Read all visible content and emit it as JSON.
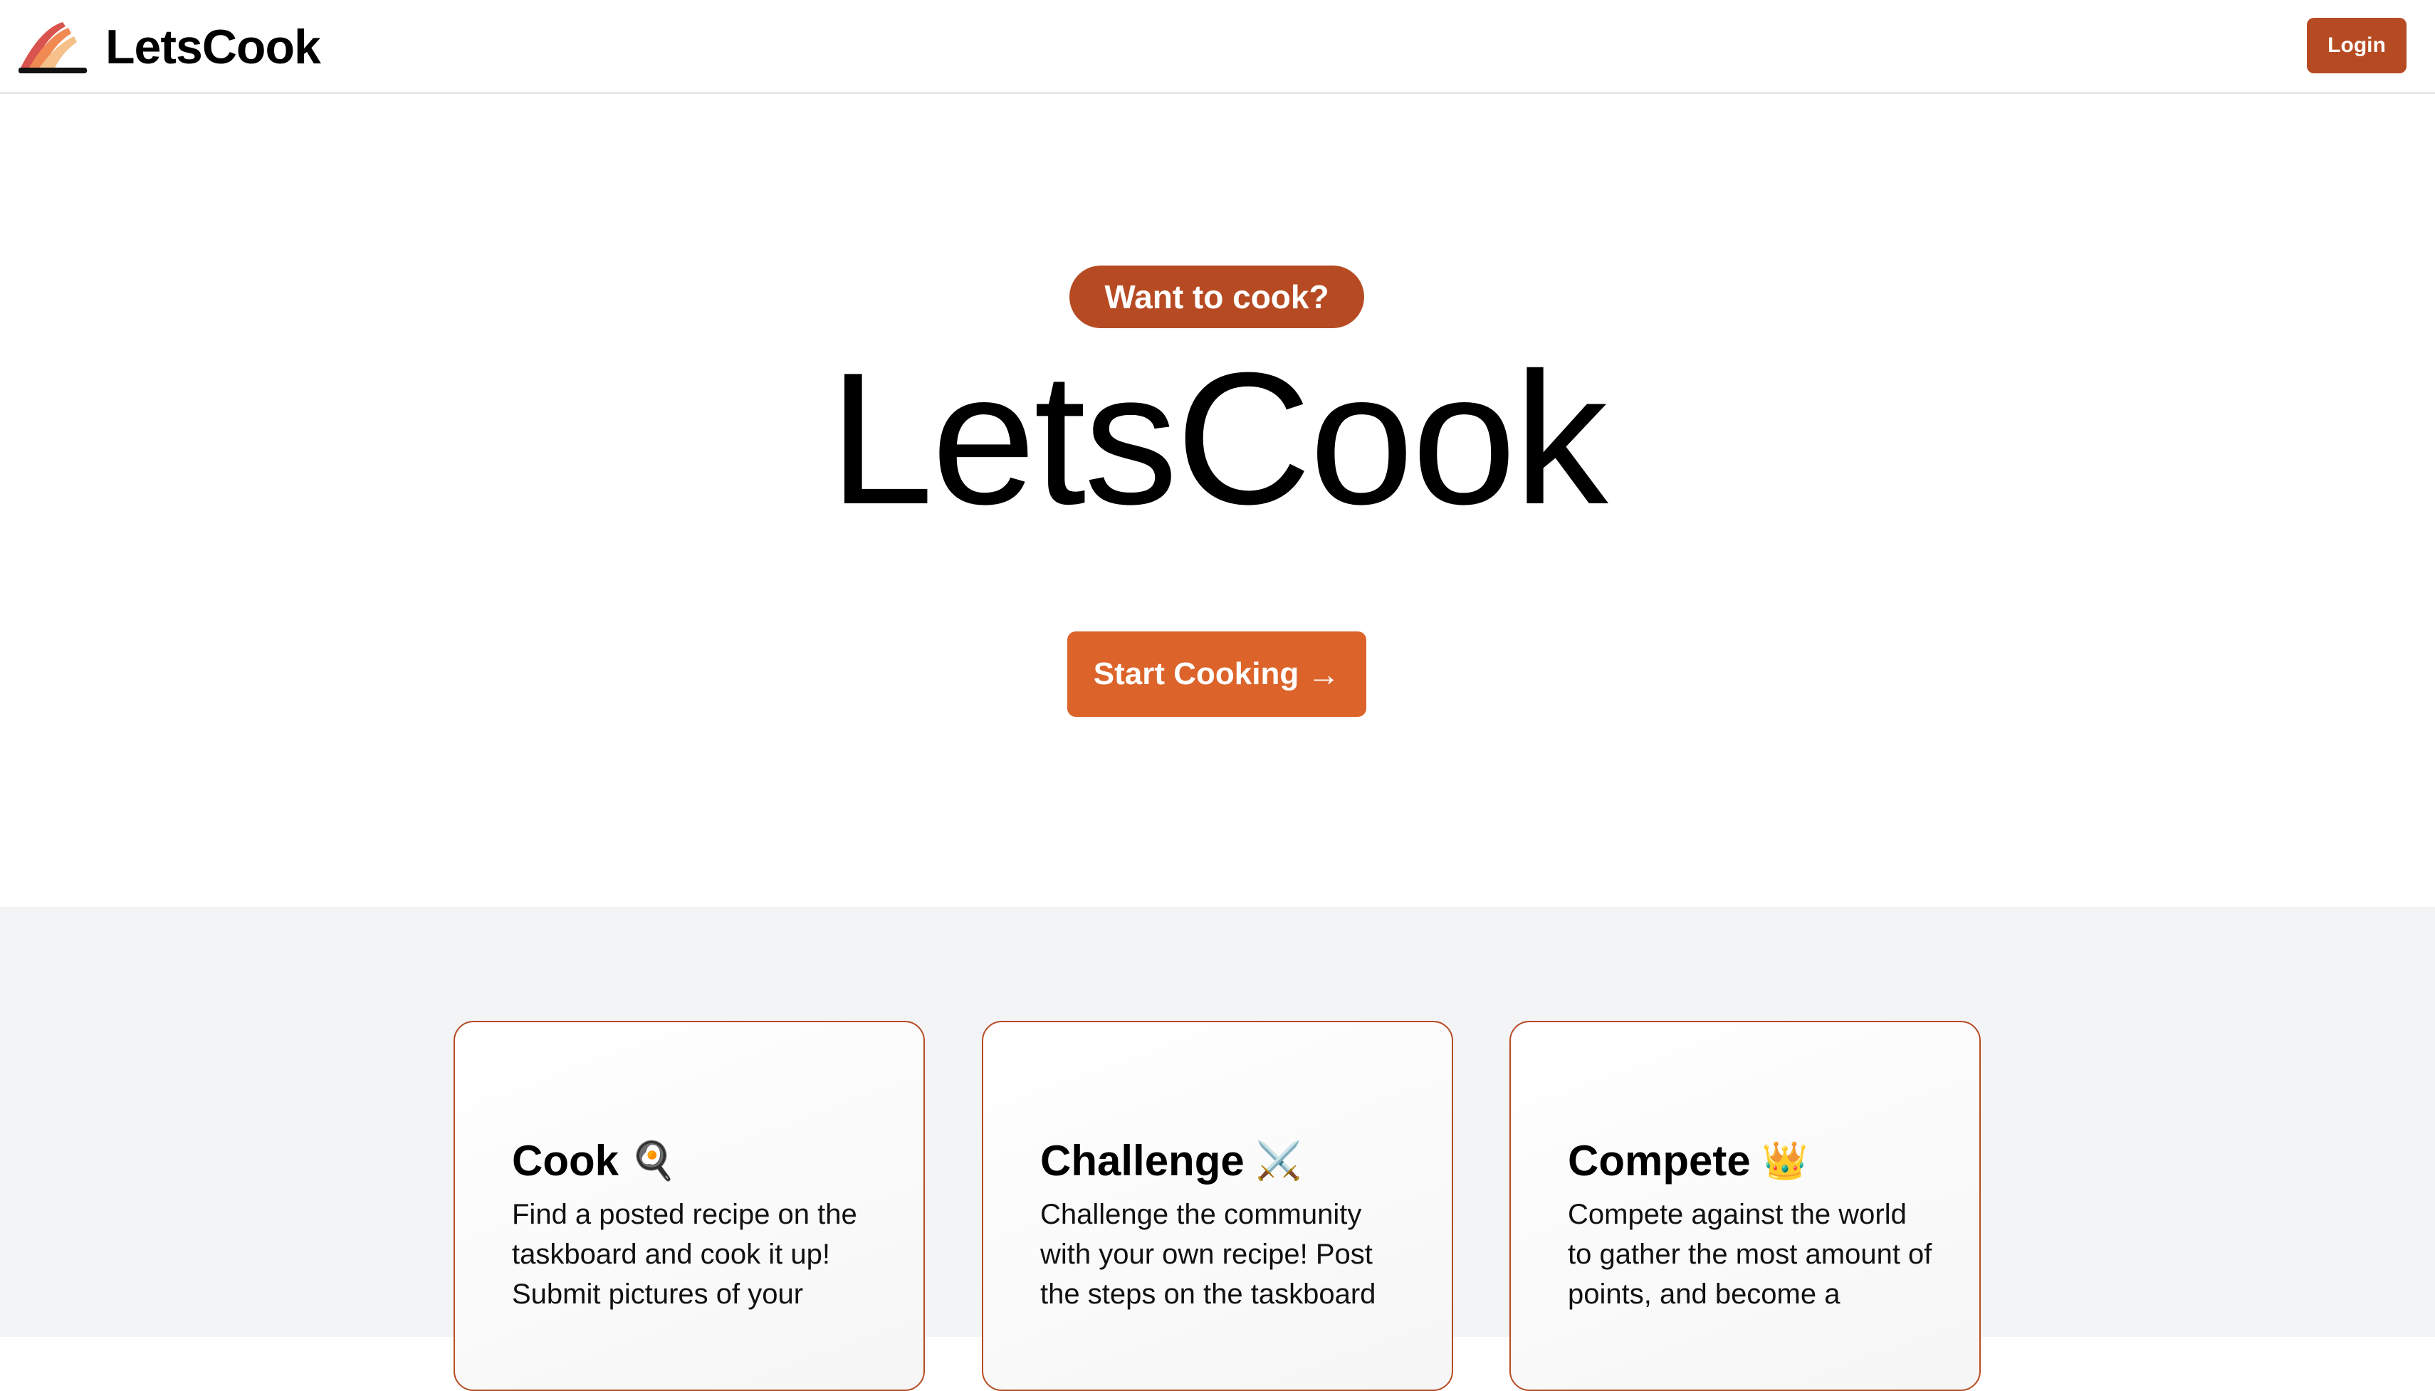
{
  "header": {
    "brand_name": "LetsCook",
    "logo_icon": "flame-stripes-logo-icon",
    "login_label": "Login"
  },
  "hero": {
    "badge": "Want to cook?",
    "title": "LetsCook",
    "cta_label": "Start Cooking",
    "cta_arrow": "→"
  },
  "features": [
    {
      "title": "Cook",
      "icon": "🍳",
      "icon_name": "frying-pan-icon",
      "text": "Find a posted recipe on the taskboard and cook it up! Submit pictures of your"
    },
    {
      "title": "Challenge",
      "icon": "⚔️",
      "icon_name": "crossed-swords-icon",
      "text": "Challenge the community with your own recipe! Post the steps on the taskboard"
    },
    {
      "title": "Compete",
      "icon": "👑",
      "icon_name": "crown-icon",
      "text": "Compete against the world to gather the most amount of points, and become a"
    }
  ],
  "colors": {
    "brand": "#b64b23",
    "cta": "#dc642b",
    "section_bg": "#f3f4f6"
  }
}
